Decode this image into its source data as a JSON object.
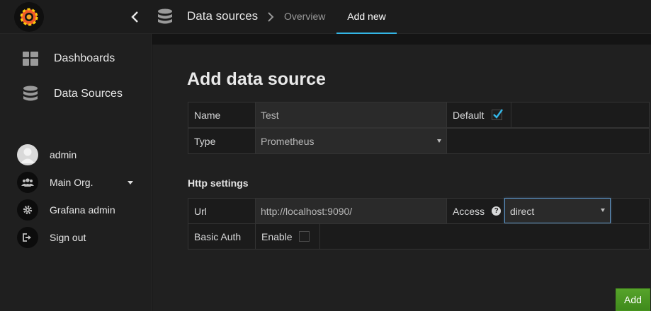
{
  "header": {
    "breadcrumb_title": "Data sources",
    "tabs": [
      {
        "label": "Overview",
        "active": false
      },
      {
        "label": "Add new",
        "active": true
      }
    ],
    "icons": [
      "grafana-logo-icon",
      "chevron-left-icon",
      "database-icon",
      "chevron-right-icon"
    ]
  },
  "sidebar": {
    "nav": [
      {
        "label": "Dashboards",
        "icon": "dashboards-grid-icon"
      },
      {
        "label": "Data Sources",
        "icon": "database-icon"
      }
    ],
    "user": [
      {
        "label": "admin",
        "icon": "user-avatar-icon"
      },
      {
        "label": "Main Org.",
        "icon": "users-group-icon"
      },
      {
        "label": "Grafana admin",
        "icon": "gear-icon"
      },
      {
        "label": "Sign out",
        "icon": "sign-out-icon"
      }
    ]
  },
  "form": {
    "title": "Add data source",
    "name_label": "Name",
    "name_value": "Test",
    "default_label": "Default",
    "default_checked": true,
    "type_label": "Type",
    "type_value": "Prometheus",
    "http_section_title": "Http settings",
    "url_label": "Url",
    "url_value": "http://localhost:9090/",
    "access_label": "Access",
    "access_value": "direct",
    "basic_auth_label": "Basic Auth",
    "basic_auth_enable_label": "Enable",
    "basic_auth_checked": false,
    "add_button_label": "Add"
  },
  "colors": {
    "accent_blue": "#33b5e5",
    "add_button_green": "#3f8a1c",
    "check_mark": "#33b5e5"
  }
}
